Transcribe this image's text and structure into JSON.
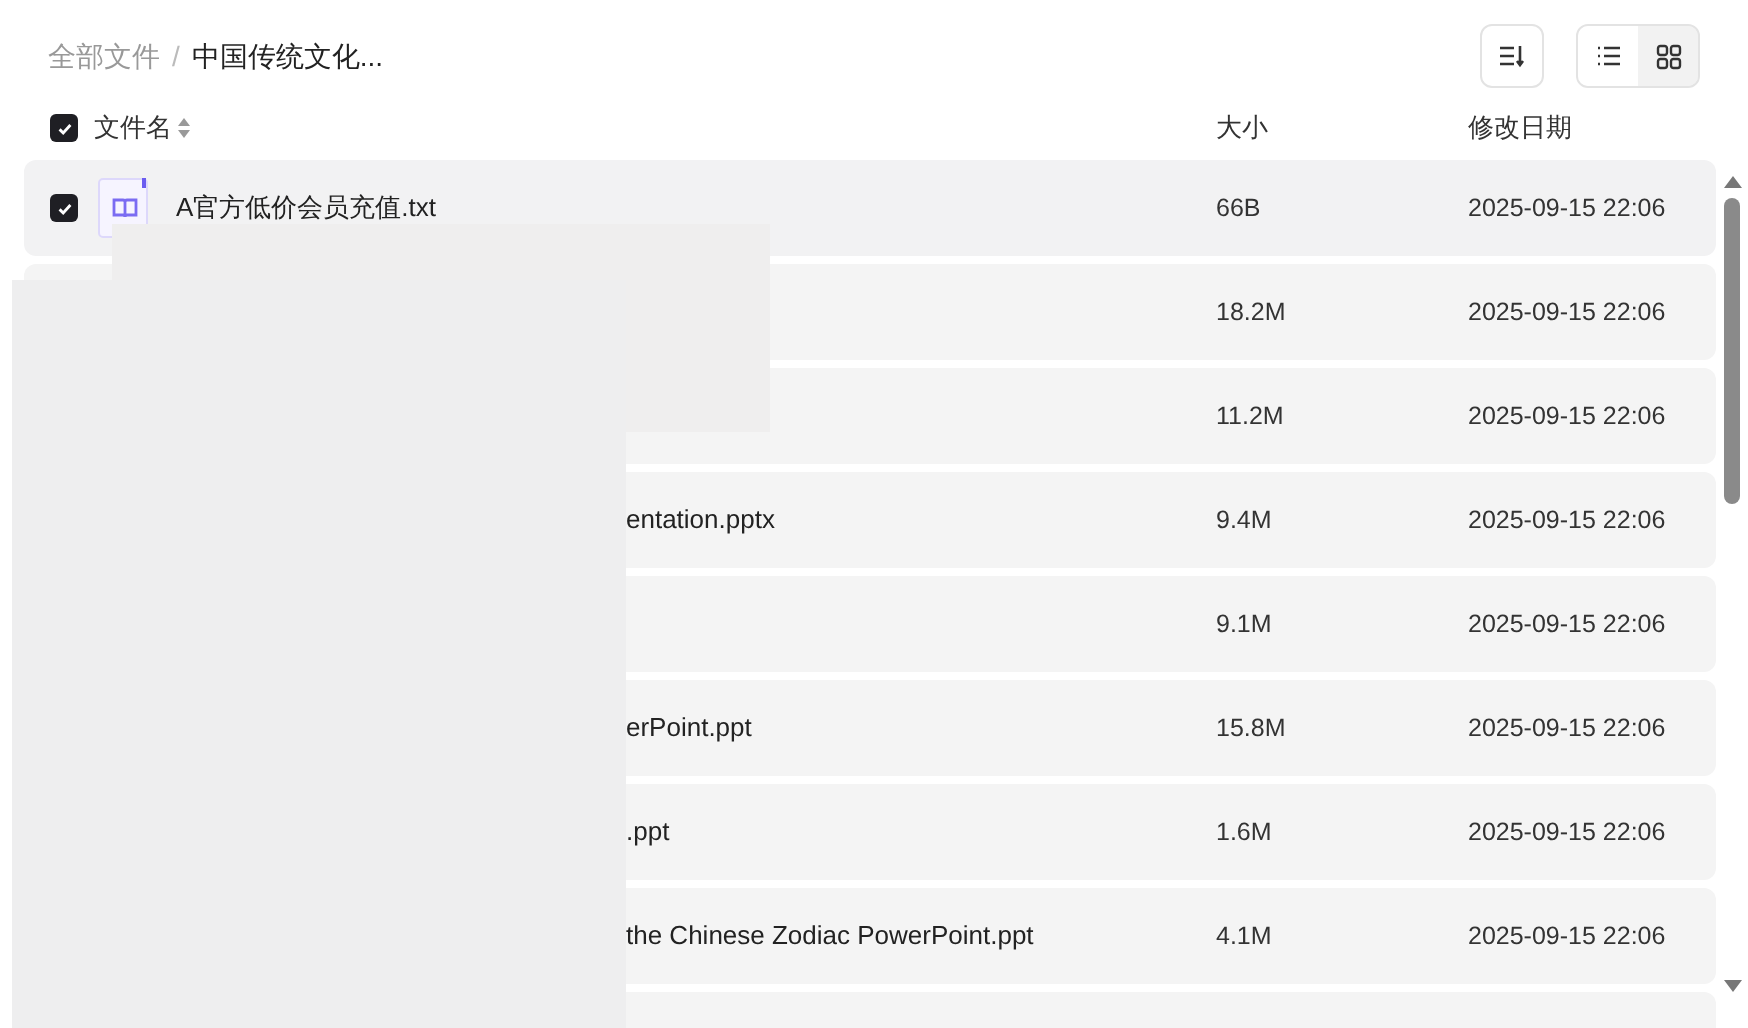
{
  "breadcrumb": [
    {
      "label": "全部文件",
      "current": false
    },
    {
      "label": "中国传统文化...",
      "current": true
    }
  ],
  "breadcrumb_separator": "/",
  "view_toggle": [
    {
      "kind": "list",
      "selected": true
    },
    {
      "kind": "grid",
      "selected": false
    }
  ],
  "table": {
    "select_all": {
      "checked": true
    },
    "columns": [
      "文件名",
      "大小",
      "修改日期"
    ],
    "rows": [
      {
        "kind": "full",
        "checked": true,
        "name": "A官方低价会员充值.txt",
        "size": "66B",
        "modified": "2025-09-15 22:06"
      },
      {
        "kind": "hidden",
        "size": "18.2M",
        "modified": "2025-09-15 22:06"
      },
      {
        "kind": "hidden",
        "size": "11.2M",
        "modified": "2025-09-15 22:06"
      },
      {
        "kind": "partial",
        "name": "entation.pptx",
        "size": "9.4M",
        "modified": "2025-09-15 22:06"
      },
      {
        "kind": "hidden",
        "size": "9.1M",
        "modified": "2025-09-15 22:06"
      },
      {
        "kind": "partial",
        "name": "erPoint.ppt",
        "size": "15.8M",
        "modified": "2025-09-15 22:06"
      },
      {
        "kind": "partial",
        "name": ".ppt",
        "size": "1.6M",
        "modified": "2025-09-15 22:06"
      },
      {
        "kind": "partial",
        "name": "the Chinese Zodiac PowerPoint.ppt",
        "size": "4.1M",
        "modified": "2025-09-15 22:06"
      },
      {
        "kind": "hidden"
      }
    ]
  }
}
